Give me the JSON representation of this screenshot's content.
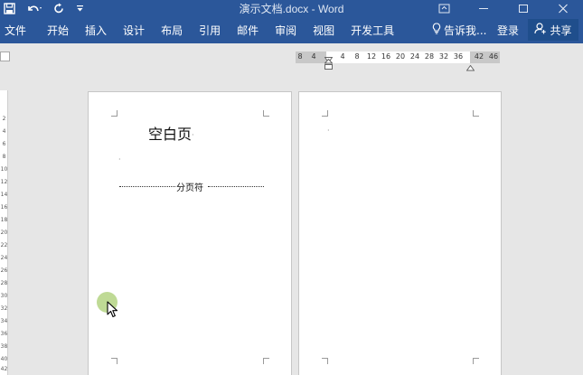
{
  "window": {
    "title": "演示文档.docx - Word"
  },
  "ribbon": {
    "tabs": [
      "文件",
      "开始",
      "插入",
      "设计",
      "布局",
      "引用",
      "邮件",
      "审阅",
      "视图",
      "开发工具"
    ],
    "tell_me": "告诉我...",
    "login": "登录",
    "share": "共享"
  },
  "ruler": {
    "horizontal_labels": [
      "8",
      "4",
      "4",
      "8",
      "12",
      "16",
      "20",
      "24",
      "28",
      "32",
      "36",
      "42",
      "46"
    ],
    "vertical_labels": [
      "2",
      "4",
      "6",
      "8",
      "10",
      "12",
      "14",
      "16",
      "18",
      "20",
      "22",
      "24",
      "26",
      "28",
      "30",
      "32",
      "34",
      "36",
      "38",
      "40",
      "42",
      "44"
    ]
  },
  "document": {
    "page1_heading": "空白页",
    "page_break_label": "分页符"
  },
  "colors": {
    "ribbon_blue": "#2b579a",
    "share_button": "#1f4e8c",
    "workspace": "#e6e6e6",
    "cursor_highlight": "#b8d68a"
  },
  "icons": [
    "save-icon",
    "undo-icon",
    "redo-icon",
    "customize-qat-icon",
    "ribbon-display-icon",
    "minimize-icon",
    "maximize-icon",
    "close-icon",
    "lightbulb-icon",
    "person-add-icon",
    "mouse-pointer-icon"
  ]
}
